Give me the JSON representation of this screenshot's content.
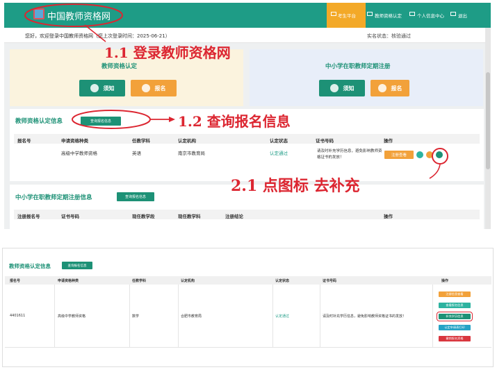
{
  "header": {
    "site_title": "中国教师资格网",
    "nav": [
      "考生平台",
      "教师资格认定",
      "个人信息中心",
      "退出"
    ]
  },
  "welcome": "您好，欢迎登录中国教师资格网（您上次登录时间：2025-06-21）",
  "realname_status": "实名状态：核验通过",
  "panels": {
    "left": {
      "title": "教师资格认定",
      "notice": "须知",
      "apply": "报名"
    },
    "right": {
      "title": "中小学在职教师定期注册",
      "notice": "须知",
      "apply": "报名"
    }
  },
  "cert_section": {
    "title": "教师资格认定信息",
    "query_button": "查询报名信息",
    "headers": [
      "报名号",
      "申请资格种类",
      "任教学科",
      "认定机构",
      "认定状态",
      "证书号码",
      "操作"
    ],
    "row": {
      "qualification": "高级中学教师资格",
      "subject": "英语",
      "agency": "南京市教育局",
      "status": "认定通过",
      "note": "请及时补充学历信息，避免影响教师资格证书的发放！",
      "action": "注册查看"
    }
  },
  "reg_section": {
    "title": "中小学在职教师定期注册信息",
    "query_button": "查询报名信息",
    "headers": [
      "注册报名号",
      "证书号码",
      "现任教学段",
      "现任教学科",
      "注册结论",
      "操作"
    ]
  },
  "annotations": {
    "a1": "1.1 登录教师资格网",
    "a2": "1.2 查询报名信息",
    "a3": "2.1 点图标 去补充"
  },
  "bottom": {
    "title": "教师资格认定信息",
    "query_button": "查询报名信息",
    "headers": [
      "报名号",
      "申请资格种类",
      "任教学科",
      "认定机构",
      "认定状态",
      "证书号码",
      "操作"
    ],
    "row": {
      "id": "4401611",
      "qualification": "高级中学教师资格",
      "subject": "数学",
      "agency": "合肥市教育局",
      "status": "认定通过",
      "note": "请及时补充学历信息，避免影响教师资格证书的发放！"
    },
    "ops": [
      "注册信息查看",
      "查看报名信息",
      "补充学历信息",
      "认定申请表打印",
      "撤销报名资格"
    ]
  },
  "colors": {
    "teal": "#1d9176",
    "orange": "#f2a13a",
    "annotation": "#dc2631"
  }
}
